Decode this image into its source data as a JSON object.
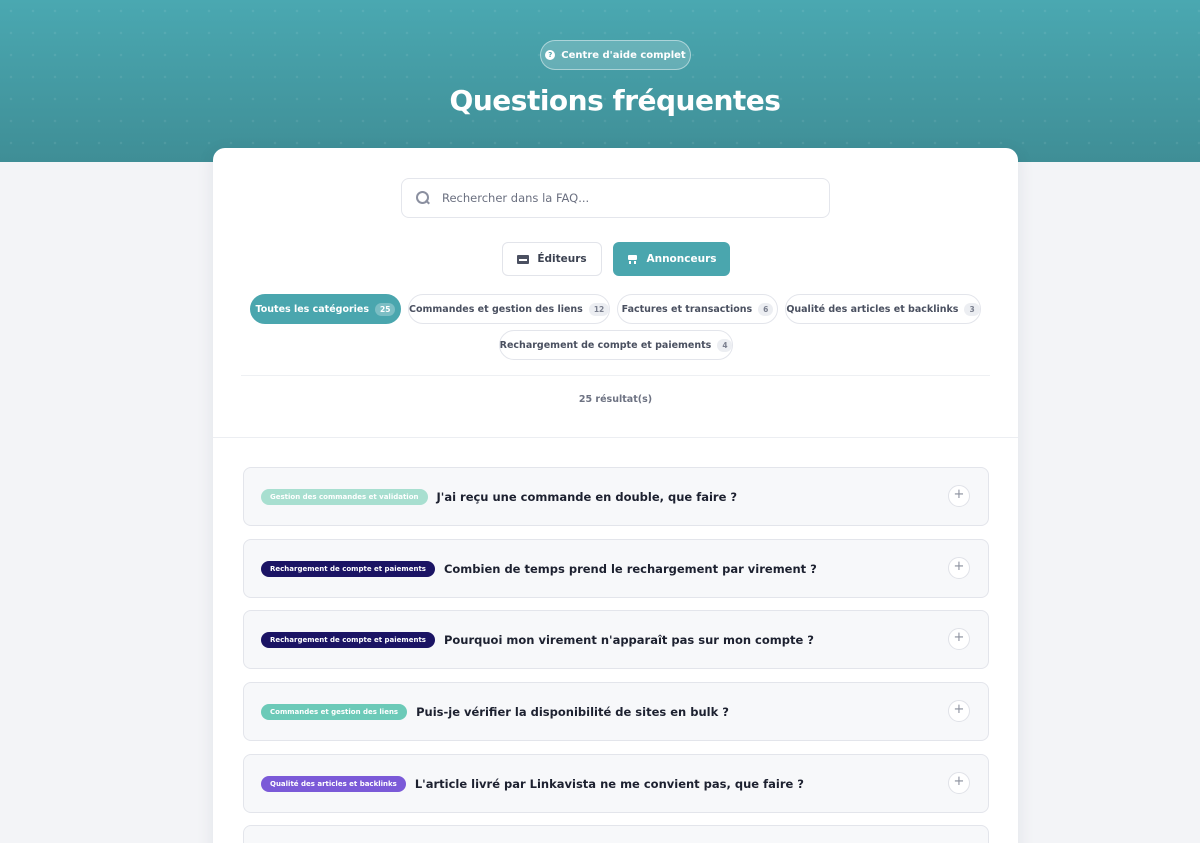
{
  "hero": {
    "badge_label": "Centre d'aide complet",
    "title": "Questions fréquentes"
  },
  "search": {
    "placeholder": "Rechercher dans la FAQ..."
  },
  "roles": {
    "editeurs": "Éditeurs",
    "annonceurs": "Annonceurs",
    "active": "annonceurs"
  },
  "categories": [
    {
      "label": "Toutes les catégories",
      "count": "25"
    },
    {
      "label": "Commandes et gestion des liens",
      "count": "12"
    },
    {
      "label": "Factures et transactions",
      "count": "6"
    },
    {
      "label": "Qualité des articles et backlinks",
      "count": "3"
    },
    {
      "label": "Rechargement de compte et paiements",
      "count": "4"
    }
  ],
  "results_text": "25 résultat(s)",
  "faq": [
    {
      "tag": "Gestion des commandes et validation",
      "question": "J'ai reçu une commande en double, que faire ?"
    },
    {
      "tag": "Rechargement de compte et paiements",
      "question": "Combien de temps prend le rechargement par virement ?"
    },
    {
      "tag": "Rechargement de compte et paiements",
      "question": "Pourquoi mon virement n'apparaît pas sur mon compte ?"
    },
    {
      "tag": "Commandes et gestion des liens",
      "question": "Puis-je vérifier la disponibilité de sites en bulk ?"
    },
    {
      "tag": "Qualité des articles et backlinks",
      "question": "L'article livré par Linkavista ne me convient pas, que faire ?"
    }
  ],
  "colors": {
    "accent": "#4aa6ae",
    "tag_gestion": "#a8dfd0",
    "tag_rechargement": "#1b1464",
    "tag_commandes": "#6ccab8",
    "tag_qualite": "#7b5ad8"
  }
}
